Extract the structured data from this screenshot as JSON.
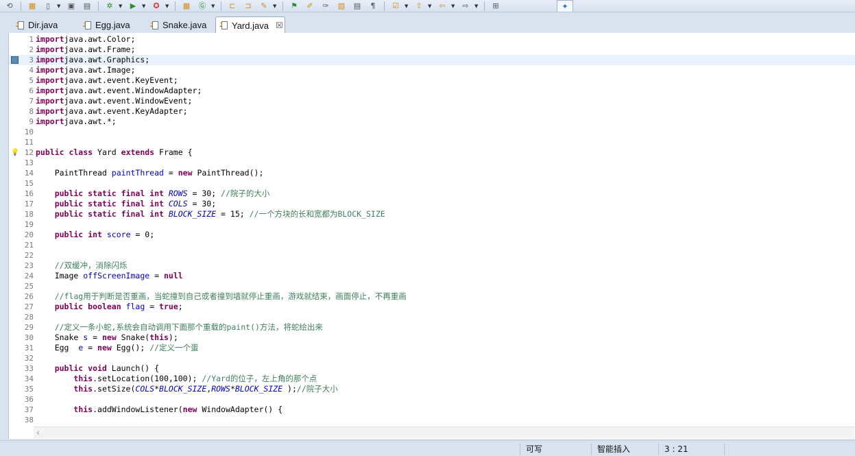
{
  "tabs": [
    {
      "label": "Dir.java",
      "active": false
    },
    {
      "label": "Egg.java",
      "active": false
    },
    {
      "label": "Snake.java",
      "active": false
    },
    {
      "label": "Yard.java",
      "active": true
    }
  ],
  "tab_close_glyph": "☒",
  "status": {
    "writable": "可写",
    "insert_mode": "智能插入",
    "position": "3 : 21"
  },
  "editor": {
    "current_line": 3,
    "lines": [
      {
        "n": "1",
        "t": [
          [
            "kw",
            "import"
          ],
          [
            "",
            "java.awt.Color;"
          ]
        ]
      },
      {
        "n": "2",
        "t": [
          [
            "kw",
            "import"
          ],
          [
            "",
            "java.awt.Frame;"
          ]
        ]
      },
      {
        "n": "3",
        "t": [
          [
            "kw",
            "import"
          ],
          [
            "",
            "java.awt.Graphics;"
          ]
        ]
      },
      {
        "n": "4",
        "t": [
          [
            "kw",
            "import"
          ],
          [
            "",
            "java.awt.Image;"
          ]
        ]
      },
      {
        "n": "5",
        "t": [
          [
            "kw",
            "import"
          ],
          [
            "",
            "java.awt.event.KeyEvent;"
          ]
        ]
      },
      {
        "n": "6",
        "t": [
          [
            "kw",
            "import"
          ],
          [
            "",
            "java.awt.event.WindowAdapter;"
          ]
        ]
      },
      {
        "n": "7",
        "t": [
          [
            "kw",
            "import"
          ],
          [
            "",
            "java.awt.event.WindowEvent;"
          ]
        ]
      },
      {
        "n": "8",
        "t": [
          [
            "kw",
            "import"
          ],
          [
            "",
            "java.awt.event.KeyAdapter;"
          ]
        ]
      },
      {
        "n": "9",
        "t": [
          [
            "kw",
            "import"
          ],
          [
            "",
            "java.awt.*;"
          ]
        ]
      },
      {
        "n": "10",
        "t": []
      },
      {
        "n": "11",
        "t": []
      },
      {
        "n": "12",
        "t": [
          [
            "kw",
            "public class"
          ],
          [
            "",
            " Yard "
          ],
          [
            "kw",
            "extends"
          ],
          [
            "",
            " Frame {"
          ]
        ]
      },
      {
        "n": "13",
        "t": []
      },
      {
        "n": "14",
        "t": [
          [
            "",
            "    PaintThread "
          ],
          [
            "field",
            "paintThread"
          ],
          [
            "",
            " = "
          ],
          [
            "kw",
            "new"
          ],
          [
            "",
            " PaintThread();"
          ]
        ]
      },
      {
        "n": "15",
        "t": []
      },
      {
        "n": "16",
        "t": [
          [
            "kw",
            "    public static final int"
          ],
          [
            "",
            " "
          ],
          [
            "sfield",
            "ROWS"
          ],
          [
            "",
            " = 30; "
          ],
          [
            "cmt",
            "//院子的大小"
          ]
        ]
      },
      {
        "n": "17",
        "t": [
          [
            "kw",
            "    public static final int"
          ],
          [
            "",
            " "
          ],
          [
            "sfield",
            "COLS"
          ],
          [
            "",
            " = 30;"
          ]
        ]
      },
      {
        "n": "18",
        "t": [
          [
            "kw",
            "    public static final int"
          ],
          [
            "",
            " "
          ],
          [
            "sfield",
            "BLOCK_SIZE"
          ],
          [
            "",
            " = 15; "
          ],
          [
            "cmt",
            "//一个方块的长和宽都为BLOCK_SIZE"
          ]
        ]
      },
      {
        "n": "19",
        "t": []
      },
      {
        "n": "20",
        "t": [
          [
            "kw",
            "    public int"
          ],
          [
            "",
            " "
          ],
          [
            "field",
            "score"
          ],
          [
            "",
            " = 0;"
          ]
        ]
      },
      {
        "n": "21",
        "t": []
      },
      {
        "n": "22",
        "t": []
      },
      {
        "n": "23",
        "t": [
          [
            "cmt",
            "    //双缓冲，消除闪烁"
          ]
        ]
      },
      {
        "n": "24",
        "t": [
          [
            "",
            "    Image "
          ],
          [
            "field",
            "offScreenImage"
          ],
          [
            "",
            " = "
          ],
          [
            "kw",
            "null"
          ],
          [
            ";"
          ]
        ]
      },
      {
        "n": "25",
        "t": []
      },
      {
        "n": "26",
        "t": [
          [
            "cmt",
            "    //flag用于判断是否重画，当蛇撞到自己或者撞到墙就停止重画，游戏就结束，画面停止，不再重画"
          ]
        ]
      },
      {
        "n": "27",
        "t": [
          [
            "kw",
            "    public boolean"
          ],
          [
            "",
            " "
          ],
          [
            "field",
            "flag"
          ],
          [
            "",
            " = "
          ],
          [
            "kw",
            "true"
          ],
          [
            "",
            ";"
          ]
        ]
      },
      {
        "n": "28",
        "t": []
      },
      {
        "n": "29",
        "t": [
          [
            "cmt",
            "    //定义一条小蛇,系统会自动调用下面那个重载的paint()方法，将蛇绘出来"
          ]
        ]
      },
      {
        "n": "30",
        "t": [
          [
            "",
            "    Snake "
          ],
          [
            "field",
            "s"
          ],
          [
            "",
            " = "
          ],
          [
            "kw",
            "new"
          ],
          [
            "",
            " Snake("
          ],
          [
            "kw",
            "this"
          ],
          [
            "",
            "); "
          ]
        ]
      },
      {
        "n": "31",
        "t": [
          [
            "",
            "    Egg  "
          ],
          [
            "field",
            "e"
          ],
          [
            "",
            " = "
          ],
          [
            "kw",
            "new"
          ],
          [
            "",
            " Egg(); "
          ],
          [
            "cmt",
            "//定义一个蛋"
          ]
        ]
      },
      {
        "n": "32",
        "t": []
      },
      {
        "n": "33",
        "t": [
          [
            "kw",
            "    public void"
          ],
          [
            "",
            " Launch() {"
          ]
        ]
      },
      {
        "n": "34",
        "t": [
          [
            "",
            "        "
          ],
          [
            "kw",
            "this"
          ],
          [
            "",
            ".setLocation(100,100); "
          ],
          [
            "cmt",
            "//Yard的位子，左上角的那个点"
          ]
        ]
      },
      {
        "n": "35",
        "t": [
          [
            "",
            "        "
          ],
          [
            "kw",
            "this"
          ],
          [
            "",
            ".setSize("
          ],
          [
            "sfield",
            "COLS"
          ],
          [
            "",
            "*"
          ],
          [
            "sfield",
            "BLOCK_SIZE"
          ],
          [
            "",
            ","
          ],
          [
            "sfield",
            "ROWS"
          ],
          [
            "",
            "*"
          ],
          [
            "sfield",
            "BLOCK_SIZE"
          ],
          [
            "",
            " );"
          ],
          [
            "cmt",
            "//院子大小"
          ]
        ]
      },
      {
        "n": "36",
        "t": []
      },
      {
        "n": "37",
        "t": [
          [
            "",
            "        "
          ],
          [
            "kw",
            "this"
          ],
          [
            "",
            ".addWindowListener("
          ],
          [
            "kw",
            "new"
          ],
          [
            "",
            " WindowAdapter() {"
          ]
        ]
      },
      {
        "n": "38",
        "t": []
      }
    ]
  }
}
